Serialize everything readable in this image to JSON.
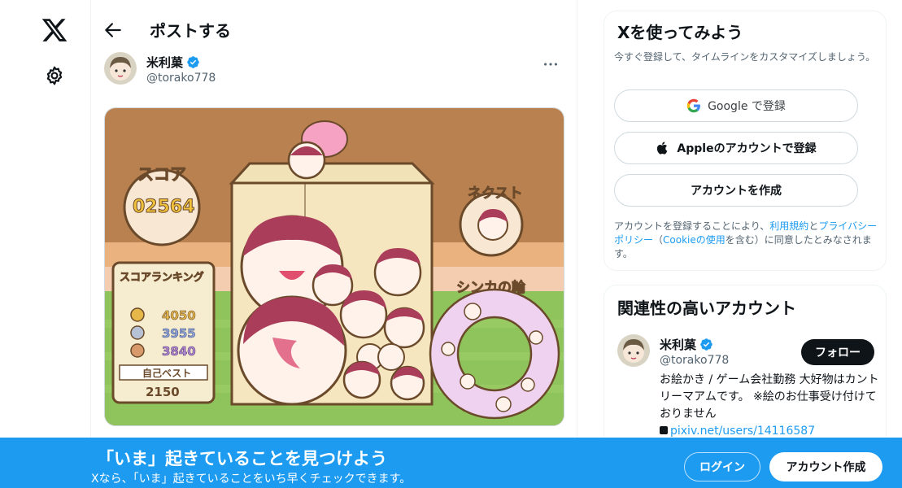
{
  "page": {
    "title": "ポストする"
  },
  "post": {
    "author_name": "米利菓",
    "author_handle": "@torako778",
    "image": {
      "texts": {
        "score_label": "スコア",
        "score_value": "02564",
        "next_label": "ネクスト",
        "ranking_label": "スコアランキング",
        "rank1": "4050",
        "rank2": "3955",
        "rank3": "3840",
        "best_label": "自己ベスト",
        "best_value": "2150",
        "ring_label": "シンカの輪"
      }
    }
  },
  "signup_card": {
    "title": "Xを使ってみよう",
    "subtitle": "今すぐ登録して、タイムラインをカスタマイズしましょう。",
    "google_label": "Google で登録",
    "apple_label": "Appleのアカウントで登録",
    "create_label": "アカウントを作成",
    "legal": {
      "prefix": "アカウントを登録することにより、",
      "terms": "利用規約",
      "and": "と",
      "privacy": "プライバシーポリシー",
      "paren_open": "（",
      "cookie": "Cookieの使用",
      "paren_close": "を含む）に同意したとみなされます。"
    }
  },
  "related_card": {
    "title": "関連性の高いアカウント",
    "account": {
      "name": "米利菓",
      "handle": "@torako778",
      "follow_label": "フォロー",
      "bio": "お絵かき / ゲーム会社勤務 大好物はカントリーマアムです。 ※絵のお仕事受け付けておりません",
      "link": "pixiv.net/users/14116587"
    }
  },
  "banner": {
    "title": "「いま」起きていることを見つけよう",
    "subtitle": "Xなら、「いま」起きていることをいち早くチェックできます。",
    "login_label": "ログイン",
    "signup_label": "アカウント作成"
  },
  "colors": {
    "accent": "#1d9bf0",
    "text": "#0f1419",
    "muted": "#536471"
  },
  "icons": [
    "x-logo-icon",
    "gear-icon",
    "back-arrow-icon",
    "verified-badge-icon",
    "more-icon",
    "google-icon",
    "apple-icon"
  ]
}
